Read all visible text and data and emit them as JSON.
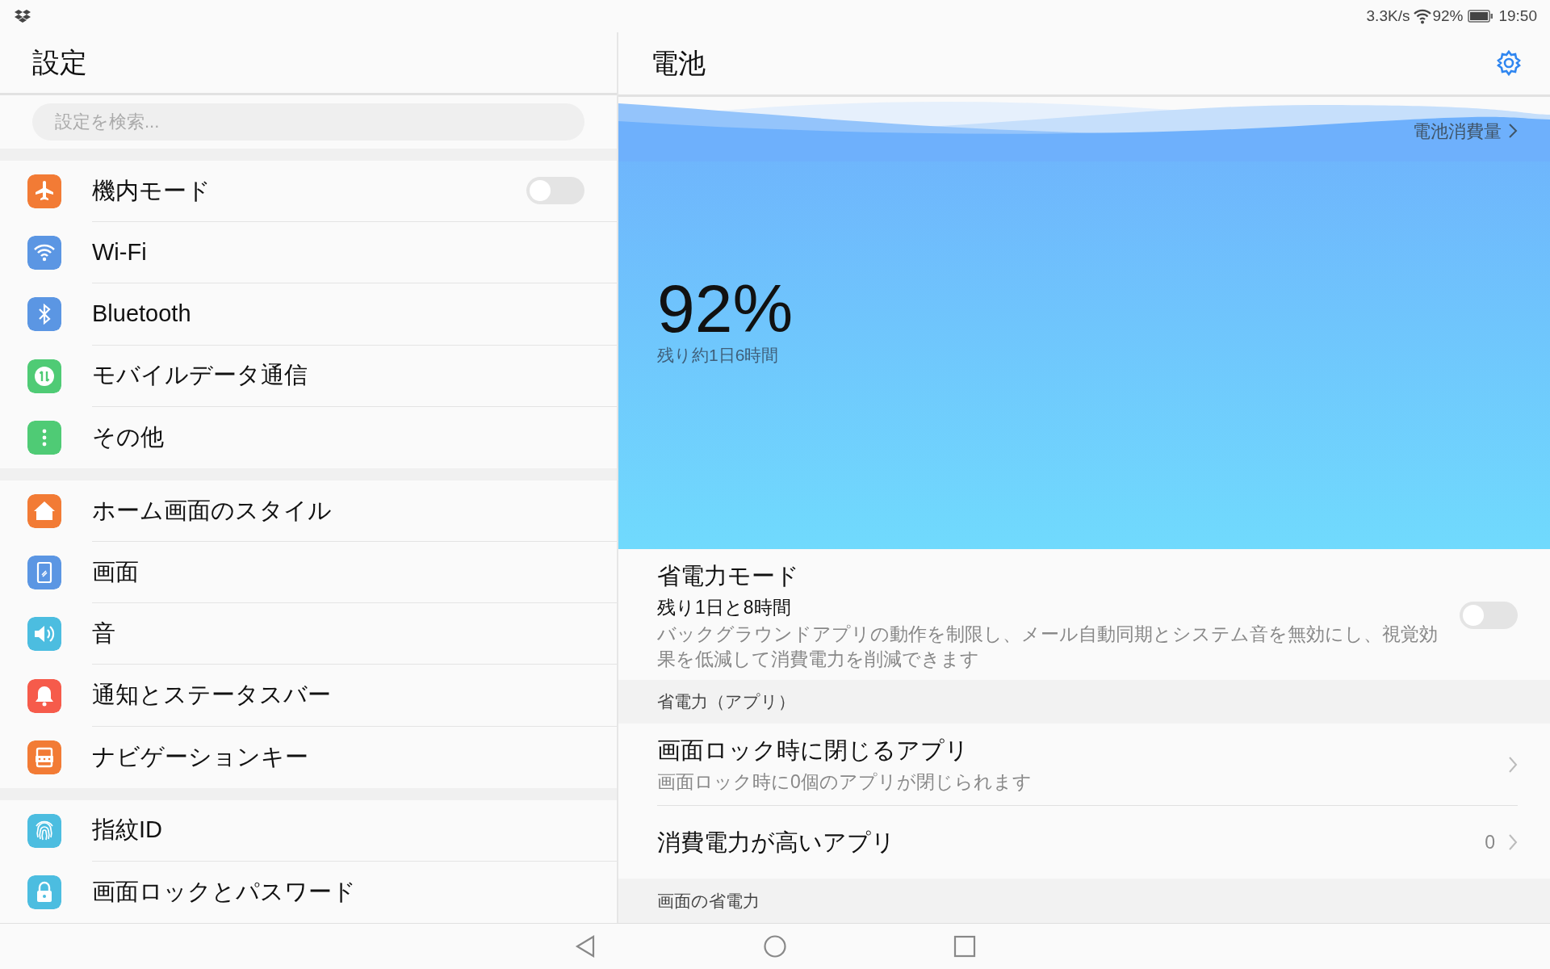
{
  "status_bar": {
    "speed": "3.3K/s",
    "battery": "92%",
    "time": "19:50"
  },
  "settings": {
    "title": "設定",
    "search": {
      "placeholder": "設定を検索..."
    },
    "groups": [
      [
        {
          "label": "機内モード",
          "color": "#f27b35",
          "kind": "toggle",
          "on": false
        },
        {
          "label": "Wi-Fi",
          "color": "#5b96e3",
          "kind": "link"
        },
        {
          "label": "Bluetooth",
          "color": "#5b96e3",
          "kind": "link"
        },
        {
          "label": "モバイルデータ通信",
          "color": "#4fcb75",
          "kind": "link"
        },
        {
          "label": "その他",
          "color": "#4fcb75",
          "kind": "link"
        }
      ],
      [
        {
          "label": "ホーム画面のスタイル",
          "color": "#f27b35",
          "kind": "link"
        },
        {
          "label": "画面",
          "color": "#5b96e3",
          "kind": "link"
        },
        {
          "label": "音",
          "color": "#4cbde0",
          "kind": "link"
        },
        {
          "label": "通知とステータスバー",
          "color": "#f65b4b",
          "kind": "link"
        },
        {
          "label": "ナビゲーションキー",
          "color": "#f27b35",
          "kind": "link"
        }
      ],
      [
        {
          "label": "指紋ID",
          "color": "#4cbde0",
          "kind": "link"
        },
        {
          "label": "画面ロックとパスワード",
          "color": "#4cbde0",
          "kind": "link"
        }
      ]
    ]
  },
  "battery": {
    "title": "電池",
    "usage_link": "電池消費量",
    "percent": "92%",
    "remaining": "残り約1日6時間",
    "power_mode": {
      "title": "省電力モード",
      "remaining": "残り1日と8時間",
      "description": "バックグラウンドアプリの動作を制限し、メール自動同期とシステム音を無効にし、視覚効果を低減して消費電力を削減できます",
      "on": false
    },
    "sections": [
      {
        "header": "省電力（アプリ）",
        "items": [
          {
            "title": "画面ロック時に閉じるアプリ",
            "subtitle": "画面ロック時に0個のアプリが閉じられます"
          },
          {
            "title": "消費電力が高いアプリ",
            "value": "0"
          }
        ]
      },
      {
        "header": "画面の省電力"
      }
    ]
  }
}
